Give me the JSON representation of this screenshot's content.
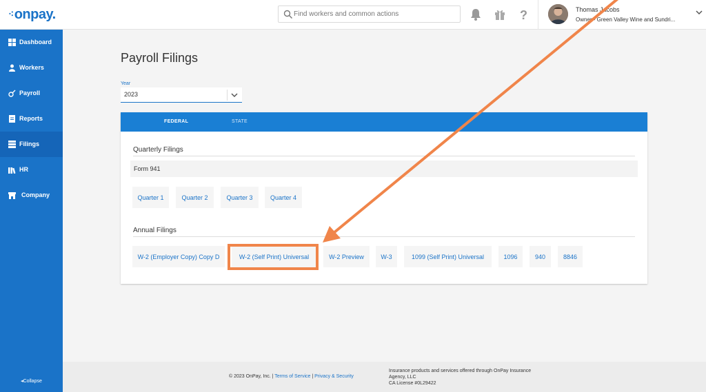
{
  "header": {
    "logo": "onpay.",
    "search_placeholder": "Find workers and common actions",
    "user_name": "Thomas Jacobs",
    "user_role": "Owner - Green Valley Wine and Sundri..."
  },
  "sidebar": {
    "items": [
      {
        "label": "Dashboard",
        "icon": "dashboard-icon"
      },
      {
        "label": "Workers",
        "icon": "workers-icon"
      },
      {
        "label": "Payroll",
        "icon": "payroll-icon"
      },
      {
        "label": "Reports",
        "icon": "reports-icon"
      },
      {
        "label": "Filings",
        "icon": "filings-icon",
        "active": true
      },
      {
        "label": "HR",
        "icon": "hr-icon"
      },
      {
        "label": "Company",
        "icon": "company-icon"
      }
    ],
    "collapse": "◂Collapse"
  },
  "main": {
    "title": "Payroll Filings",
    "year_label": "Year",
    "year_value": "2023",
    "tabs": [
      "FEDERAL",
      "STATE"
    ],
    "quarterly": {
      "title": "Quarterly Filings",
      "form": "Form 941",
      "buttons": [
        "Quarter 1",
        "Quarter 2",
        "Quarter 3",
        "Quarter 4"
      ]
    },
    "annual": {
      "title": "Annual Filings",
      "buttons": [
        "W-2 (Employer Copy) Copy D",
        "W-2 (Self Print) Universal",
        "W-2 Preview",
        "W-3",
        "1099 (Self Print) Universal",
        "1096",
        "940",
        "8846"
      ]
    }
  },
  "footer": {
    "copyright": "© 2023 OnPay, Inc. |",
    "terms": "Terms of Service",
    "sep": "|",
    "privacy": "Privacy & Security",
    "insurance": "Insurance products and services offered through OnPay Insurance Agency, LLC",
    "license": "CA License #0L29422"
  },
  "colors": {
    "brand": "#1a73c8",
    "annotation": "#f0854a"
  }
}
